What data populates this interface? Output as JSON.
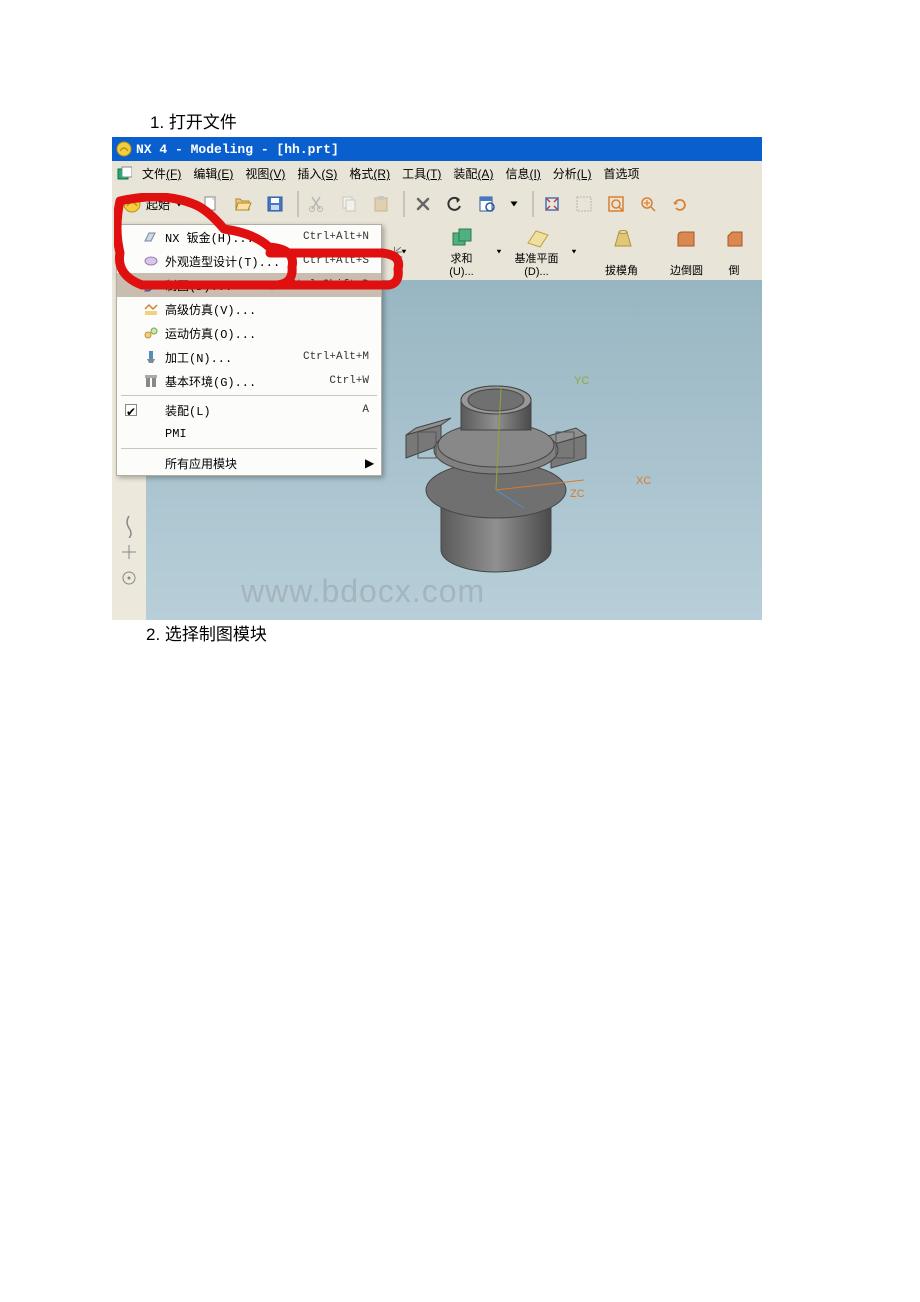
{
  "captions": {
    "step1": "1. 打开文件",
    "step2": "2. 选择制图模块"
  },
  "title_bar": {
    "text": "NX 4 - Modeling - [hh.prt]"
  },
  "menu_bar": {
    "items": [
      {
        "label": "文件",
        "accel": "(F)"
      },
      {
        "label": "编辑",
        "accel": "(E)"
      },
      {
        "label": "视图",
        "accel": "(V)"
      },
      {
        "label": "插入",
        "accel": "(S)"
      },
      {
        "label": "格式",
        "accel": "(R)"
      },
      {
        "label": "工具",
        "accel": "(T)"
      },
      {
        "label": "装配",
        "accel": "(A)"
      },
      {
        "label": "信息",
        "accel": "(I)"
      },
      {
        "label": "分析",
        "accel": "(L)"
      },
      {
        "label": "首选项"
      }
    ]
  },
  "toolbar": {
    "start_label": "起始"
  },
  "toolbar2": {
    "items": [
      {
        "label": "求和",
        "sub": "(U)..."
      },
      {
        "label": "基准平面",
        "sub": "(D)..."
      },
      {
        "label": "拔模角",
        "sub": ""
      },
      {
        "label": "边倒圆",
        "sub": ""
      },
      {
        "label": "倒",
        "sub": ""
      }
    ]
  },
  "start_menu": {
    "items": [
      {
        "icon": "sheetmetal-icon",
        "label": "NX 钣金(H)...",
        "shortcut": "Ctrl+Alt+N"
      },
      {
        "icon": "shape-icon",
        "label": "外观造型设计(T)...",
        "shortcut": "Ctrl+Alt+S"
      },
      {
        "icon": "drafting-icon",
        "label": "制图(D)...",
        "shortcut": "Ctrl+Shift+D",
        "highlight": true
      },
      {
        "icon": "sim-icon",
        "label": "高级仿真(V)...",
        "shortcut": ""
      },
      {
        "icon": "motion-icon",
        "label": "运动仿真(O)...",
        "shortcut": ""
      },
      {
        "icon": "mfg-icon",
        "label": "加工(N)...",
        "shortcut": "Ctrl+Alt+M"
      },
      {
        "icon": "gateway-icon",
        "label": "基本环境(G)...",
        "shortcut": "Ctrl+W"
      },
      {
        "sep": true
      },
      {
        "icon": "",
        "label": "装配(L)",
        "shortcut": "A",
        "checked": true
      },
      {
        "icon": "",
        "label": "PMI",
        "shortcut": ""
      },
      {
        "sep": true
      },
      {
        "icon": "",
        "label": "所有应用模块",
        "shortcut": "",
        "arrow": true
      }
    ]
  },
  "axes": {
    "xc": "XC",
    "yc": "YC",
    "zc": "ZC"
  },
  "watermark": "www.bdocx.com"
}
